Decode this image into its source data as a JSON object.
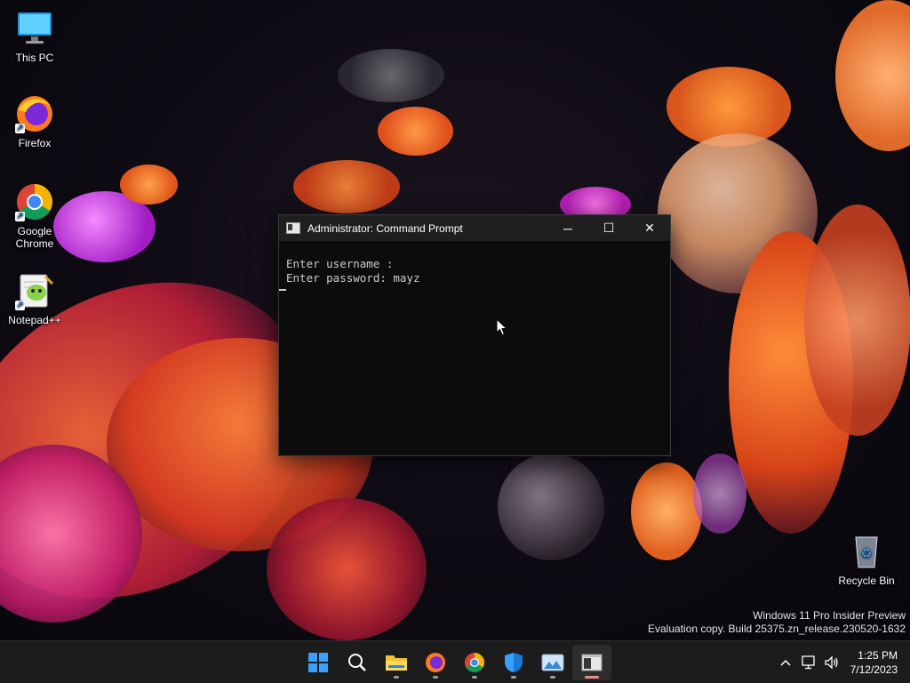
{
  "desktop": {
    "icons": [
      {
        "label": "This PC"
      },
      {
        "label": "Firefox"
      },
      {
        "label": "Google Chrome"
      },
      {
        "label": "Notepad++"
      },
      {
        "label": "Recycle Bin"
      }
    ]
  },
  "cmd_window": {
    "title": "Administrator:  Command Prompt",
    "lines": [
      "Enter username :",
      "Enter password: mayz"
    ],
    "controls": {
      "minimize": "─",
      "maximize": "☐",
      "close": "✕"
    }
  },
  "watermark": {
    "line1": "Windows 11 Pro Insider Preview",
    "line2": "Evaluation copy. Build 25375.zn_release.230520-1632"
  },
  "taskbar": {
    "apps": [
      {
        "name": "start-button",
        "icon": "windows-logo-icon"
      },
      {
        "name": "search-button",
        "icon": "search-icon"
      },
      {
        "name": "file-explorer",
        "icon": "folder-icon"
      },
      {
        "name": "firefox",
        "icon": "firefox-icon"
      },
      {
        "name": "chrome",
        "icon": "chrome-icon"
      },
      {
        "name": "windows-security",
        "icon": "shield-icon"
      },
      {
        "name": "photos",
        "icon": "photos-icon"
      },
      {
        "name": "command-prompt",
        "icon": "cmd-icon"
      }
    ],
    "tray": {
      "chevron_icon": "chevron-up-icon",
      "network_icon": "network-icon",
      "volume_icon": "volume-icon",
      "time": "1:25 PM",
      "date": "7/12/2023"
    }
  },
  "colors": {
    "taskbar_bg": "#1c1c1c",
    "cmd_bg": "#0c0c0c",
    "accent": "#0078d4"
  }
}
